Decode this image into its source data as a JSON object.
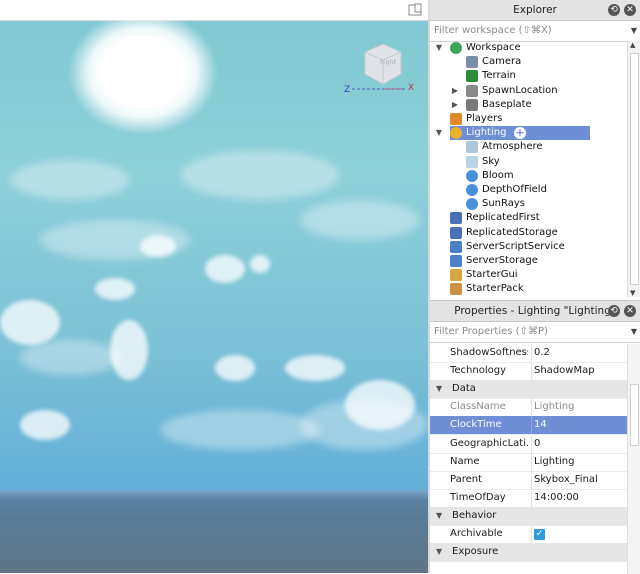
{
  "explorer": {
    "title": "Explorer",
    "filter_placeholder": "Filter workspace (⇧⌘X)",
    "items": [
      {
        "label": "Workspace",
        "icon": "workspace-globe-icon",
        "indent": 0,
        "arrow": "expanded"
      },
      {
        "label": "Camera",
        "icon": "camera-icon",
        "indent": 1,
        "arrow": "none"
      },
      {
        "label": "Terrain",
        "icon": "terrain-icon",
        "indent": 1,
        "arrow": "none"
      },
      {
        "label": "SpawnLocation",
        "icon": "spawn-gear-icon",
        "indent": 1,
        "arrow": "collapsed"
      },
      {
        "label": "Baseplate",
        "icon": "part-cube-icon",
        "indent": 1,
        "arrow": "collapsed"
      },
      {
        "label": "Players",
        "icon": "players-icon",
        "indent": 0,
        "arrow": "none"
      },
      {
        "label": "Lighting",
        "icon": "lighting-bulb-icon",
        "indent": 0,
        "arrow": "expanded",
        "selected": true
      },
      {
        "label": "Atmosphere",
        "icon": "atmosphere-icon",
        "indent": 1,
        "arrow": "none"
      },
      {
        "label": "Sky",
        "icon": "sky-icon",
        "indent": 1,
        "arrow": "none"
      },
      {
        "label": "Bloom",
        "icon": "post-effect-icon",
        "indent": 1,
        "arrow": "none"
      },
      {
        "label": "DepthOfField",
        "icon": "post-effect-icon",
        "indent": 1,
        "arrow": "none"
      },
      {
        "label": "SunRays",
        "icon": "post-effect-icon",
        "indent": 1,
        "arrow": "none"
      },
      {
        "label": "ReplicatedFirst",
        "icon": "replicated-first-icon",
        "indent": 0,
        "arrow": "none"
      },
      {
        "label": "ReplicatedStorage",
        "icon": "replicated-storage-icon",
        "indent": 0,
        "arrow": "none"
      },
      {
        "label": "ServerScriptService",
        "icon": "server-script-service-icon",
        "indent": 0,
        "arrow": "none"
      },
      {
        "label": "ServerStorage",
        "icon": "server-storage-icon",
        "indent": 0,
        "arrow": "none"
      },
      {
        "label": "StarterGui",
        "icon": "starter-gui-icon",
        "indent": 0,
        "arrow": "none"
      },
      {
        "label": "StarterPack",
        "icon": "starter-pack-icon",
        "indent": 0,
        "arrow": "none"
      }
    ]
  },
  "properties": {
    "title": "Properties - Lighting \"Lighting\"",
    "filter_placeholder": "Filter Properties (⇧⌘P)",
    "rows": [
      {
        "type": "prop",
        "name": "ShadowSoftness",
        "value": "0.2"
      },
      {
        "type": "prop",
        "name": "Technology",
        "value": "ShadowMap"
      },
      {
        "type": "section",
        "name": "Data"
      },
      {
        "type": "prop",
        "name": "ClassName",
        "value": "Lighting",
        "readonly": true
      },
      {
        "type": "prop",
        "name": "ClockTime",
        "value": "14",
        "selected": true
      },
      {
        "type": "prop",
        "name": "GeographicLati...",
        "value": "0"
      },
      {
        "type": "prop",
        "name": "Name",
        "value": "Lighting"
      },
      {
        "type": "prop",
        "name": "Parent",
        "value": "Skybox_Final"
      },
      {
        "type": "prop",
        "name": "TimeOfDay",
        "value": "14:00:00"
      },
      {
        "type": "section",
        "name": "Behavior"
      },
      {
        "type": "prop",
        "name": "Archivable",
        "value": "",
        "checkbox": true,
        "checked": true
      },
      {
        "type": "section",
        "name": "Exposure"
      }
    ]
  },
  "viewport": {
    "view_cube_face": "Right",
    "axis_labels": {
      "z": "Z",
      "x": "X"
    }
  },
  "colors": {
    "selection": "#6e8fd6",
    "checkbox": "#2f9ae0",
    "sky_top": "#7fc7d1",
    "sky_bottom": "#5da9d8"
  }
}
